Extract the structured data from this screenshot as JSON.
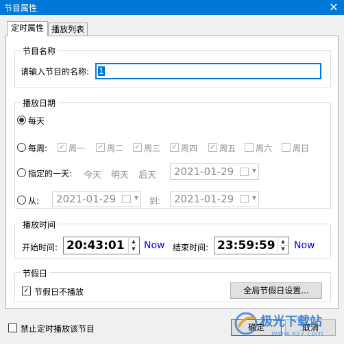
{
  "window": {
    "title": "节目属性",
    "close_glyph": "✕"
  },
  "tabs": [
    {
      "label": "定时属性",
      "active": true
    },
    {
      "label": "播放列表",
      "active": false
    }
  ],
  "name_group": {
    "title": "节目名称",
    "label": "请输入节目的名称:",
    "value": "1"
  },
  "date_group": {
    "title": "播放日期",
    "daily": "每天",
    "weekly": "每周:",
    "weekdays": [
      {
        "label": "周一",
        "checked": true
      },
      {
        "label": "周二",
        "checked": true
      },
      {
        "label": "周三",
        "checked": true
      },
      {
        "label": "周四",
        "checked": true
      },
      {
        "label": "周五",
        "checked": true
      },
      {
        "label": "周六",
        "checked": false
      },
      {
        "label": "周日",
        "checked": false
      }
    ],
    "specific_day": "指定的一天:",
    "quick_days": [
      "今天",
      "明天",
      "后天"
    ],
    "specific_date": "2021-01-29",
    "from": "从:",
    "from_date": "2021-01-29",
    "to": "到:",
    "to_date": "2021-01-29",
    "selected": "每天"
  },
  "time_group": {
    "title": "播放时间",
    "start_label": "开始时间:",
    "start_value": "20:43:01",
    "now_label": "Now",
    "end_label": "结束时间:",
    "end_value": "23:59:59",
    "now_label_2": "Now"
  },
  "holiday_group": {
    "title": "节假日",
    "no_play_label": "节假日不播放",
    "no_play_checked": true,
    "global_settings": "全局节假日设置..."
  },
  "footer": {
    "disable_label": "禁止定时播放该节目",
    "disable_checked": false,
    "ok": "确定",
    "cancel": "取消"
  },
  "watermark": {
    "text": "极光下载站",
    "url": "www.xz7.com"
  },
  "colors": {
    "titlebar": "#0078d7",
    "accent": "#0000ee"
  }
}
